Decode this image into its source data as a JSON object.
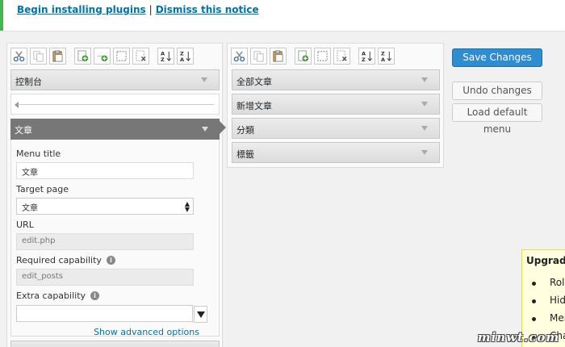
{
  "notice": {
    "install_link": "Begin installing plugins",
    "separator": "|",
    "dismiss_link": "Dismiss this notice"
  },
  "left_panel": {
    "top_item": "控制台",
    "active_item": "文章",
    "fields": {
      "menu_title_label": "Menu title",
      "menu_title_value": "文章",
      "target_page_label": "Target page",
      "target_page_value": "文章",
      "url_label": "URL",
      "url_value": "edit.php",
      "required_cap_label": "Required capability",
      "required_cap_value": "edit_posts",
      "extra_cap_label": "Extra capability",
      "extra_cap_value": ""
    },
    "advanced_link": "Show advanced options"
  },
  "mid_panel": {
    "items": [
      "全部文章",
      "新增文章",
      "分類",
      "標籤"
    ]
  },
  "actions": {
    "save": "Save Changes",
    "undo": "Undo changes",
    "load_default": "Load default menu"
  },
  "upgrade": {
    "title": "Upgrade",
    "items": [
      "Role",
      "Hide",
      "Men",
      "Cha"
    ]
  },
  "watermark": "minwt.com",
  "icons": [
    "cut-icon",
    "copy-icon",
    "paste-icon",
    "new-menu-icon",
    "new-separator-icon",
    "select-icon",
    "delete-icon",
    "sort-asc-icon",
    "sort-desc-icon",
    "help-icon"
  ],
  "colors": {
    "notice_border": "#46b450",
    "link": "#0073aa",
    "primary_button": "#2e8ccf",
    "active_item": "#777777",
    "upgrade_box": "#ffffe0"
  }
}
